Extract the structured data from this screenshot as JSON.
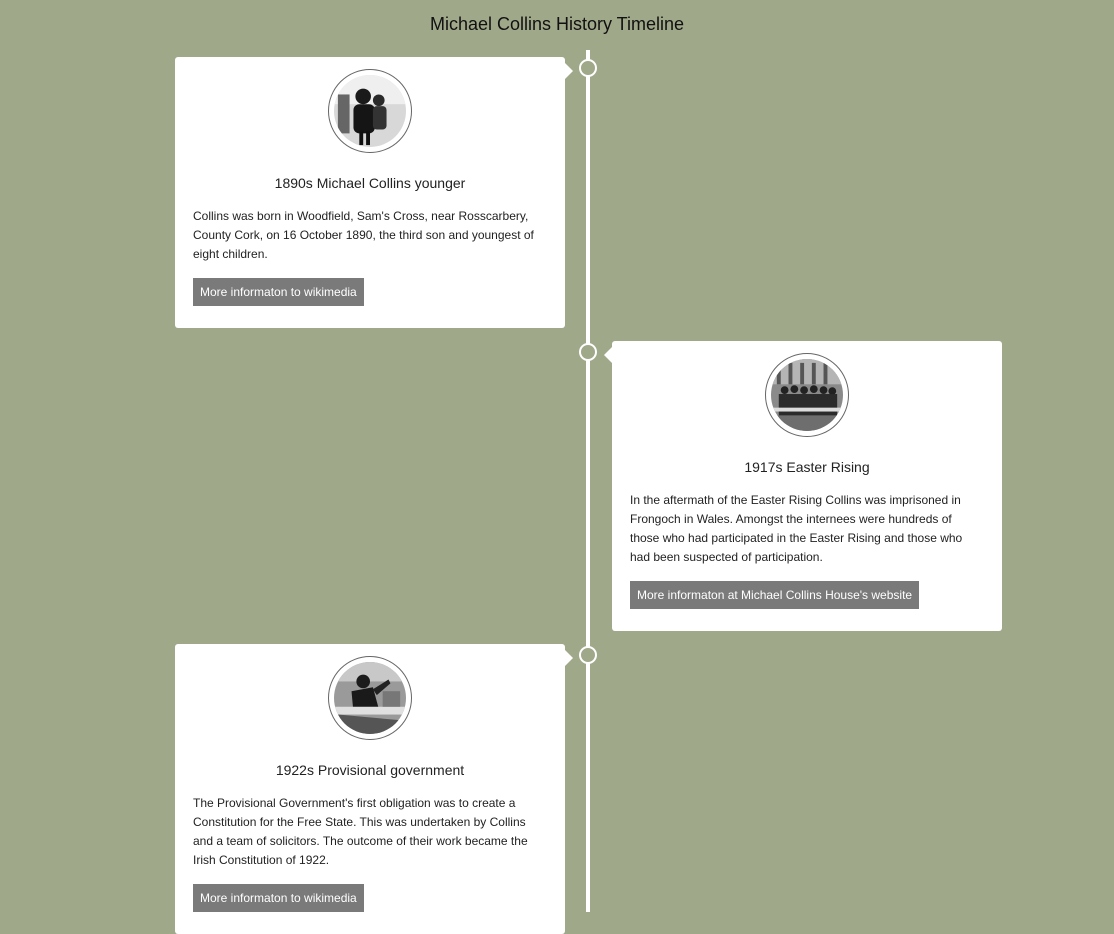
{
  "page": {
    "title": "Michael Collins History Timeline"
  },
  "colors": {
    "background": "#a0a88a",
    "card": "#ffffff",
    "timeline_line": "#ffffff",
    "button": "#7a7a7a"
  },
  "events": [
    {
      "title": "1890s Michael Collins younger",
      "text": "Collins was born in Woodfield, Sam's Cross, near Rosscarbery, County Cork, on 16 October 1890, the third son and youngest of eight children.",
      "link_label": "More informaton to wikimedia",
      "side": "left",
      "image": "portrait-photo"
    },
    {
      "title": "1917s Easter Rising",
      "text": "In the aftermath of the Easter Rising Collins was imprisoned in Frongoch in Wales. Amongst the internees were hundreds of those who had participated in the Easter Rising and those who had been suspected of participation.",
      "link_label": "More informaton at Michael Collins House's website",
      "side": "right",
      "image": "group-photo"
    },
    {
      "title": "1922s Provisional government",
      "text": "The Provisional Government's first obligation was to create a Constitution for the Free State. This was undertaken by Collins and a team of solicitors. The outcome of their work became the Irish Constitution of 1922.",
      "link_label": "More informaton to wikimedia",
      "side": "left",
      "image": "speech-photo"
    }
  ]
}
